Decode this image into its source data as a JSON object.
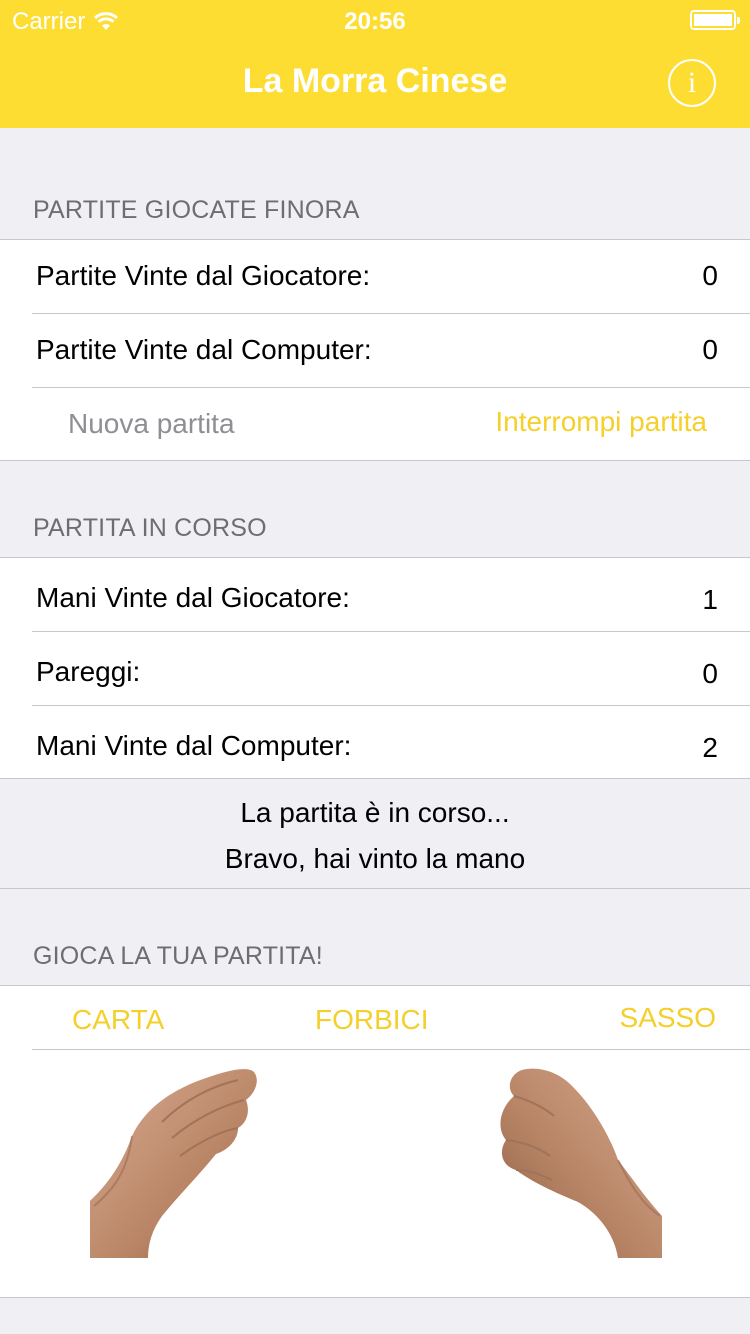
{
  "status_bar": {
    "carrier": "Carrier",
    "time": "20:56",
    "icons": [
      "wifi-icon",
      "battery-icon"
    ]
  },
  "nav": {
    "title": "La Morra Cinese",
    "info_label": "i"
  },
  "games_section": {
    "header": "PARTITE GIOCATE FINORA",
    "rows": [
      {
        "label": "Partite Vinte dal Giocatore:",
        "value": "0"
      },
      {
        "label": "Partite Vinte dal Computer:",
        "value": "0"
      }
    ],
    "new_game_label": "Nuova partita",
    "stop_game_label": "Interrompi partita"
  },
  "current_section": {
    "header": "PARTITA IN CORSO",
    "rows": [
      {
        "label": "Mani Vinte dal Giocatore:",
        "value": "1"
      },
      {
        "label": "Pareggi:",
        "value": "0"
      },
      {
        "label": "Mani Vinte dal Computer:",
        "value": "2"
      }
    ]
  },
  "status_messages": {
    "line1": "La partita è in corso...",
    "line2": "Bravo, hai vinto la mano"
  },
  "play_section": {
    "header": "GIOCA LA TUA PARTITA!",
    "choices": [
      "CARTA",
      "FORBICI",
      "SASSO"
    ],
    "player_hand": "paper-hand-icon",
    "computer_hand": "rock-hand-icon"
  },
  "colors": {
    "accent": "#fedd33",
    "accent_text": "#f5cf2a",
    "background": "#efeff4"
  }
}
